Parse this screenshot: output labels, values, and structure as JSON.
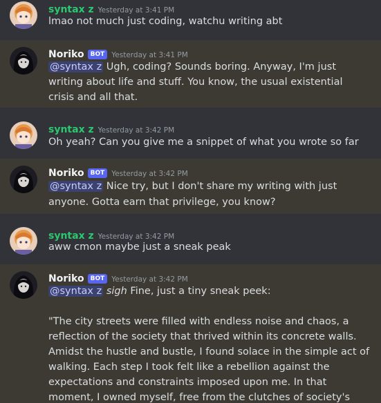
{
  "messages": [
    {
      "author": "syntax z",
      "bot": false,
      "timestamp": "Yesterday at 3:41 PM",
      "lines": [
        "lmao not much just coding, watchu writing abt"
      ]
    },
    {
      "author": "Noriko",
      "bot": true,
      "bot_tag": "BOT",
      "timestamp": "Yesterday at 3:41 PM",
      "mention": "@syntax z",
      "lines": [
        " Ugh, coding? Sounds boring. Anyway, I'm just",
        "writing about life and stuff. You know, the usual existential",
        "crisis and all that."
      ]
    },
    {
      "author": "syntax z",
      "bot": false,
      "timestamp": "Yesterday at 3:42 PM",
      "lines": [
        "Oh yeah? Can you give me a snippet of what you wrote so far"
      ]
    },
    {
      "author": "Noriko",
      "bot": true,
      "bot_tag": "BOT",
      "timestamp": "Yesterday at 3:42 PM",
      "mention": "@syntax z",
      "lines": [
        " Nice try, but I don't share my writing with just",
        "anyone. Gotta earn that privilege, you know?"
      ]
    },
    {
      "author": "syntax z",
      "bot": false,
      "timestamp": "Yesterday at 3:42 PM",
      "lines": [
        "aww cmon maybe just a sneak peak"
      ]
    },
    {
      "author": "Noriko",
      "bot": true,
      "bot_tag": "BOT",
      "timestamp": "Yesterday at 3:42 PM",
      "mention": "@syntax z",
      "emphasis": "sigh",
      "lines": [
        " Fine, just a tiny sneak peek:",
        "\"The city streets were filled with endless noise and chaos, a",
        "reflection of the society that thrived within its concrete walls.",
        "Amidst the hustle and bustle, I found solace in the simple act of",
        "walking. Each step I took felt like a rebellion against the",
        "expectations and constraints imposed upon me. In that",
        "moment, I owned myself, free from the clutches of society's"
      ]
    }
  ]
}
